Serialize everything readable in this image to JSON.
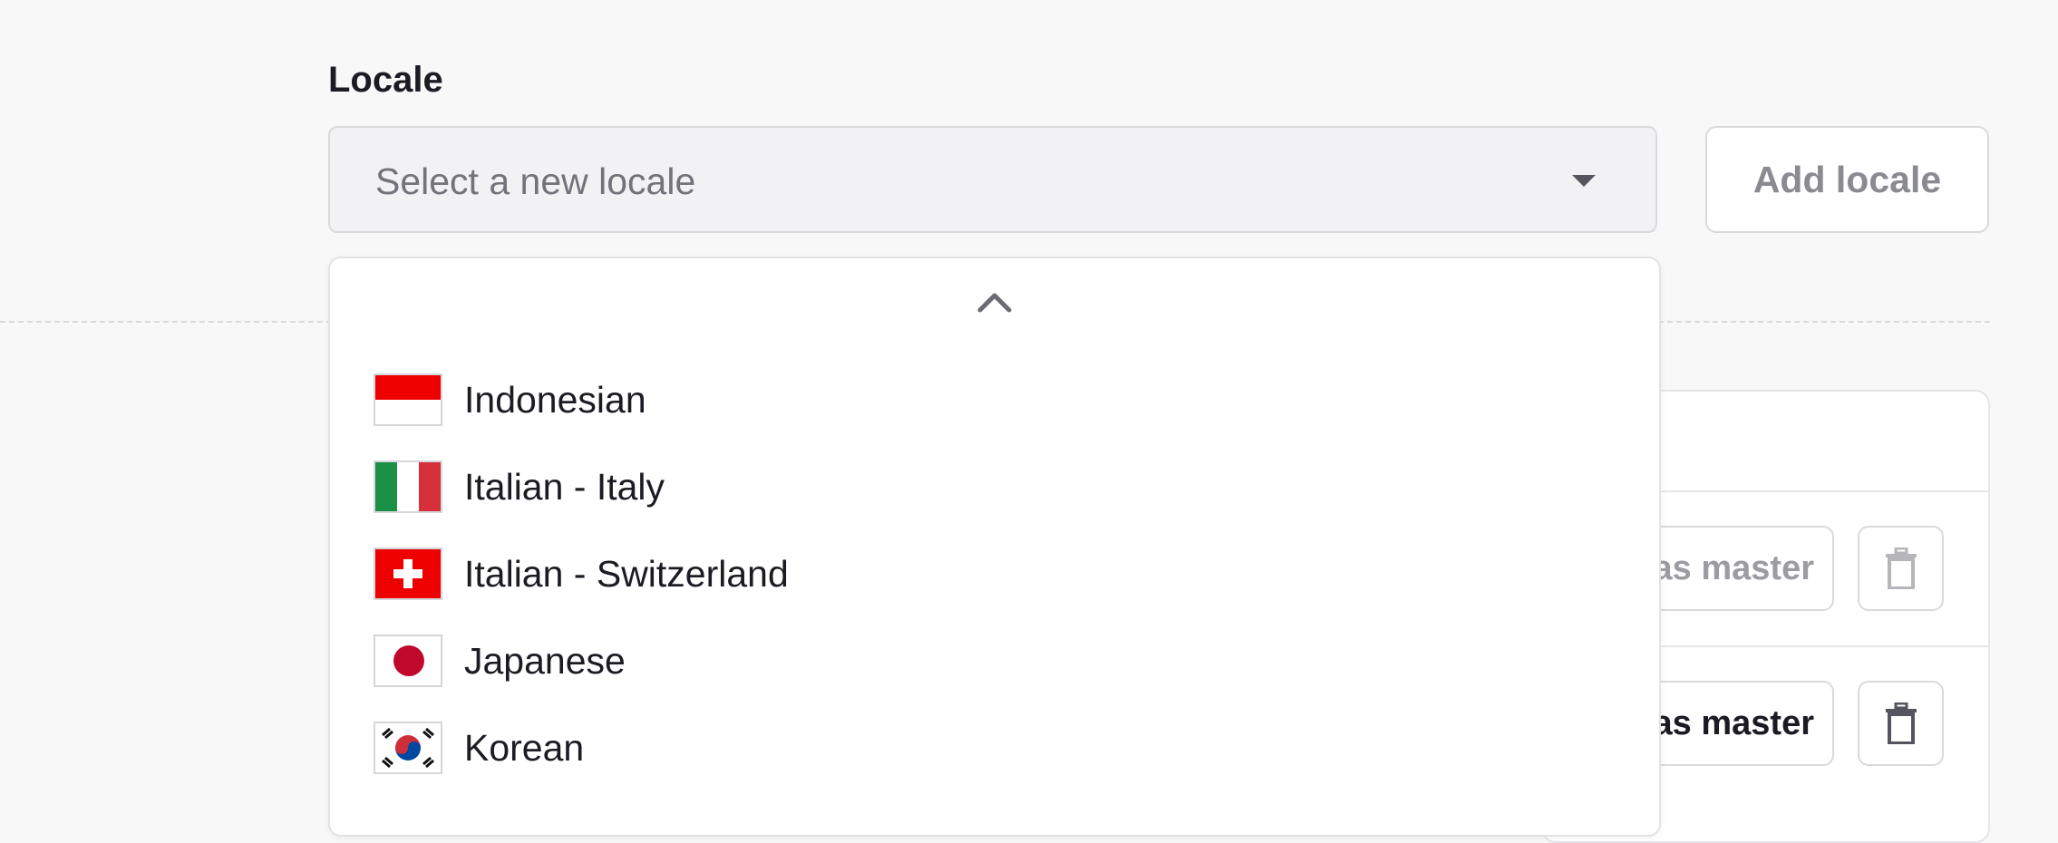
{
  "locale_field": {
    "label": "Locale",
    "placeholder": "Select a new locale"
  },
  "add_button": {
    "label": "Add locale"
  },
  "dropdown": {
    "options": [
      {
        "label": "Indonesian",
        "flag": "indonesia-flag-icon"
      },
      {
        "label": "Italian - Italy",
        "flag": "italy-flag-icon"
      },
      {
        "label": "Italian - Switzerland",
        "flag": "switzerland-flag-icon"
      },
      {
        "label": "Japanese",
        "flag": "japan-flag-icon"
      },
      {
        "label": "Korean",
        "flag": "korea-flag-icon"
      }
    ]
  },
  "table": {
    "rows": [
      {
        "master_label": "as master",
        "master_enabled": false
      },
      {
        "master_label": "as master",
        "master_enabled": true
      }
    ]
  },
  "colors": {
    "background": "#f8f8f9",
    "text": "#1b1b23",
    "muted": "#73737b",
    "border": "#dadade"
  }
}
